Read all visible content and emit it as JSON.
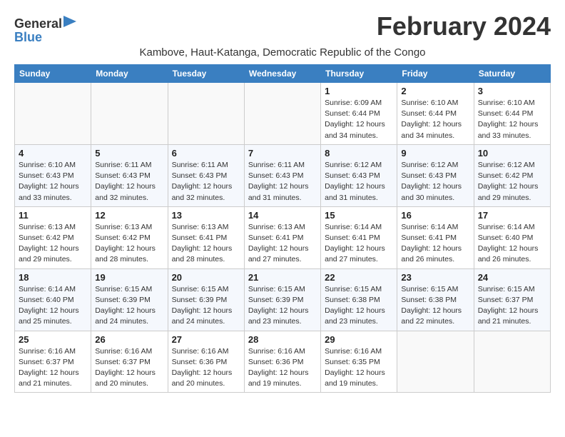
{
  "header": {
    "logo_general": "General",
    "logo_blue": "Blue",
    "month_title": "February 2024",
    "subtitle": "Kambove, Haut-Katanga, Democratic Republic of the Congo"
  },
  "columns": [
    "Sunday",
    "Monday",
    "Tuesday",
    "Wednesday",
    "Thursday",
    "Friday",
    "Saturday"
  ],
  "weeks": [
    [
      {
        "day": "",
        "info": ""
      },
      {
        "day": "",
        "info": ""
      },
      {
        "day": "",
        "info": ""
      },
      {
        "day": "",
        "info": ""
      },
      {
        "day": "1",
        "info": "Sunrise: 6:09 AM\nSunset: 6:44 PM\nDaylight: 12 hours\nand 34 minutes."
      },
      {
        "day": "2",
        "info": "Sunrise: 6:10 AM\nSunset: 6:44 PM\nDaylight: 12 hours\nand 34 minutes."
      },
      {
        "day": "3",
        "info": "Sunrise: 6:10 AM\nSunset: 6:44 PM\nDaylight: 12 hours\nand 33 minutes."
      }
    ],
    [
      {
        "day": "4",
        "info": "Sunrise: 6:10 AM\nSunset: 6:43 PM\nDaylight: 12 hours\nand 33 minutes."
      },
      {
        "day": "5",
        "info": "Sunrise: 6:11 AM\nSunset: 6:43 PM\nDaylight: 12 hours\nand 32 minutes."
      },
      {
        "day": "6",
        "info": "Sunrise: 6:11 AM\nSunset: 6:43 PM\nDaylight: 12 hours\nand 32 minutes."
      },
      {
        "day": "7",
        "info": "Sunrise: 6:11 AM\nSunset: 6:43 PM\nDaylight: 12 hours\nand 31 minutes."
      },
      {
        "day": "8",
        "info": "Sunrise: 6:12 AM\nSunset: 6:43 PM\nDaylight: 12 hours\nand 31 minutes."
      },
      {
        "day": "9",
        "info": "Sunrise: 6:12 AM\nSunset: 6:43 PM\nDaylight: 12 hours\nand 30 minutes."
      },
      {
        "day": "10",
        "info": "Sunrise: 6:12 AM\nSunset: 6:42 PM\nDaylight: 12 hours\nand 29 minutes."
      }
    ],
    [
      {
        "day": "11",
        "info": "Sunrise: 6:13 AM\nSunset: 6:42 PM\nDaylight: 12 hours\nand 29 minutes."
      },
      {
        "day": "12",
        "info": "Sunrise: 6:13 AM\nSunset: 6:42 PM\nDaylight: 12 hours\nand 28 minutes."
      },
      {
        "day": "13",
        "info": "Sunrise: 6:13 AM\nSunset: 6:41 PM\nDaylight: 12 hours\nand 28 minutes."
      },
      {
        "day": "14",
        "info": "Sunrise: 6:13 AM\nSunset: 6:41 PM\nDaylight: 12 hours\nand 27 minutes."
      },
      {
        "day": "15",
        "info": "Sunrise: 6:14 AM\nSunset: 6:41 PM\nDaylight: 12 hours\nand 27 minutes."
      },
      {
        "day": "16",
        "info": "Sunrise: 6:14 AM\nSunset: 6:41 PM\nDaylight: 12 hours\nand 26 minutes."
      },
      {
        "day": "17",
        "info": "Sunrise: 6:14 AM\nSunset: 6:40 PM\nDaylight: 12 hours\nand 26 minutes."
      }
    ],
    [
      {
        "day": "18",
        "info": "Sunrise: 6:14 AM\nSunset: 6:40 PM\nDaylight: 12 hours\nand 25 minutes."
      },
      {
        "day": "19",
        "info": "Sunrise: 6:15 AM\nSunset: 6:39 PM\nDaylight: 12 hours\nand 24 minutes."
      },
      {
        "day": "20",
        "info": "Sunrise: 6:15 AM\nSunset: 6:39 PM\nDaylight: 12 hours\nand 24 minutes."
      },
      {
        "day": "21",
        "info": "Sunrise: 6:15 AM\nSunset: 6:39 PM\nDaylight: 12 hours\nand 23 minutes."
      },
      {
        "day": "22",
        "info": "Sunrise: 6:15 AM\nSunset: 6:38 PM\nDaylight: 12 hours\nand 23 minutes."
      },
      {
        "day": "23",
        "info": "Sunrise: 6:15 AM\nSunset: 6:38 PM\nDaylight: 12 hours\nand 22 minutes."
      },
      {
        "day": "24",
        "info": "Sunrise: 6:15 AM\nSunset: 6:37 PM\nDaylight: 12 hours\nand 21 minutes."
      }
    ],
    [
      {
        "day": "25",
        "info": "Sunrise: 6:16 AM\nSunset: 6:37 PM\nDaylight: 12 hours\nand 21 minutes."
      },
      {
        "day": "26",
        "info": "Sunrise: 6:16 AM\nSunset: 6:37 PM\nDaylight: 12 hours\nand 20 minutes."
      },
      {
        "day": "27",
        "info": "Sunrise: 6:16 AM\nSunset: 6:36 PM\nDaylight: 12 hours\nand 20 minutes."
      },
      {
        "day": "28",
        "info": "Sunrise: 6:16 AM\nSunset: 6:36 PM\nDaylight: 12 hours\nand 19 minutes."
      },
      {
        "day": "29",
        "info": "Sunrise: 6:16 AM\nSunset: 6:35 PM\nDaylight: 12 hours\nand 19 minutes."
      },
      {
        "day": "",
        "info": ""
      },
      {
        "day": "",
        "info": ""
      }
    ]
  ]
}
